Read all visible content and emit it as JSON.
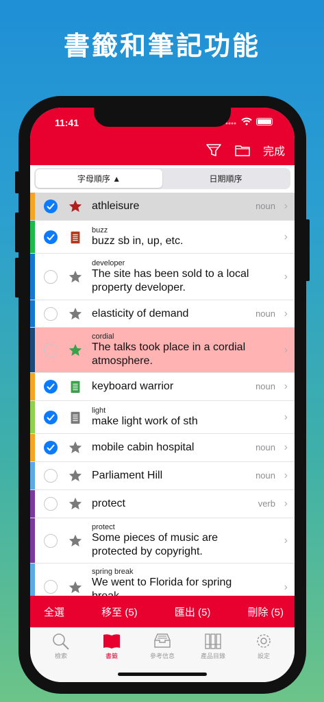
{
  "promo": {
    "title": "書籤和筆記功能"
  },
  "status": {
    "time": "11:41"
  },
  "topbar": {
    "done_label": "完成"
  },
  "sort": {
    "alpha_label": "字母順序 ▲",
    "date_label": "日期順序"
  },
  "colors": {
    "accent": "#e8002f",
    "check": "#0a7aff",
    "highlight": "#ffb3b3"
  },
  "rows": [
    {
      "checked": true,
      "icon": "star-icon",
      "small": "",
      "main": "athleisure",
      "pos": "noun"
    },
    {
      "checked": true,
      "icon": "note-icon",
      "small": "buzz",
      "main": "buzz sb in, up, etc.",
      "pos": ""
    },
    {
      "checked": false,
      "icon": "star-icon",
      "small": "developer",
      "main": "The site has been sold to a local property developer.",
      "pos": ""
    },
    {
      "checked": false,
      "icon": "star-icon",
      "small": "",
      "main": "elasticity of demand",
      "pos": "noun"
    },
    {
      "checked": false,
      "icon": "star-icon",
      "small": "cordial",
      "main": "The talks took place in a cordial atmosphere.",
      "pos": ""
    },
    {
      "checked": true,
      "icon": "note-icon",
      "small": "",
      "main": "keyboard warrior",
      "pos": "noun"
    },
    {
      "checked": true,
      "icon": "note-icon",
      "small": "light",
      "main": "make light work of sth",
      "pos": ""
    },
    {
      "checked": true,
      "icon": "star-icon",
      "small": "",
      "main": "mobile cabin hospital",
      "pos": "noun"
    },
    {
      "checked": false,
      "icon": "star-icon",
      "small": "",
      "main": "Parliament Hill",
      "pos": "noun"
    },
    {
      "checked": false,
      "icon": "star-icon",
      "small": "",
      "main": "protect",
      "pos": "verb"
    },
    {
      "checked": false,
      "icon": "star-icon",
      "small": "protect",
      "main": "Some pieces of music are protected by copyright.",
      "pos": ""
    },
    {
      "checked": false,
      "icon": "star-icon",
      "small": "spring break",
      "main": "We went to Florida for spring break.",
      "pos": ""
    }
  ],
  "actions": {
    "select_all": "全選",
    "move": "移至 (5)",
    "export": "匯出 (5)",
    "delete": "刪除 (5)"
  },
  "tabs": [
    {
      "label": "檢索",
      "icon": "search-icon"
    },
    {
      "label": "書籤",
      "icon": "book-icon"
    },
    {
      "label": "參考信息",
      "icon": "tray-icon"
    },
    {
      "label": "產品目錄",
      "icon": "books-icon"
    },
    {
      "label": "設定",
      "icon": "gear-icon"
    }
  ]
}
